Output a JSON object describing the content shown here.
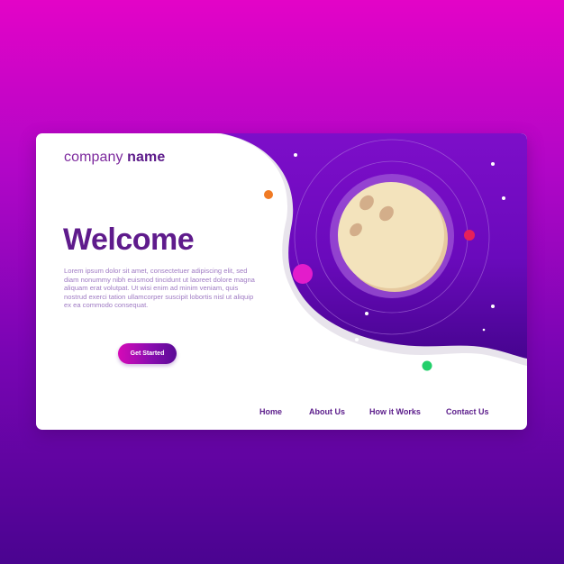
{
  "brand": {
    "name_light": "company",
    "name_bold": "name"
  },
  "hero": {
    "title": "Welcome",
    "body": "Lorem ipsum dolor sit amet, consectetuer adipiscing elit, sed diam nonummy nibh euismod tincidunt ut laoreet dolore magna aliquam erat volutpat. Ut wisi enim ad minim veniam, quis nostrud exerci tation ullamcorper suscipit lobortis nisl ut aliquip ex ea commodo consequat.",
    "cta_label": "Get Started"
  },
  "nav": {
    "items": [
      "Home",
      "About Us",
      "How it Works",
      "Contact Us"
    ]
  },
  "illustration": {
    "icons": [
      "moon-icon",
      "orbit-ring-icon",
      "planet-dot-icon",
      "star-icon"
    ]
  },
  "colors": {
    "background_top": "#e304c7",
    "background_bottom": "#4a0490",
    "primary_purple": "#5f1b8c",
    "moon": "#f3e3bc",
    "accent_orange": "#f07a24",
    "accent_magenta": "#e31ccb",
    "accent_red": "#e5205a",
    "accent_green": "#22cf6a"
  }
}
